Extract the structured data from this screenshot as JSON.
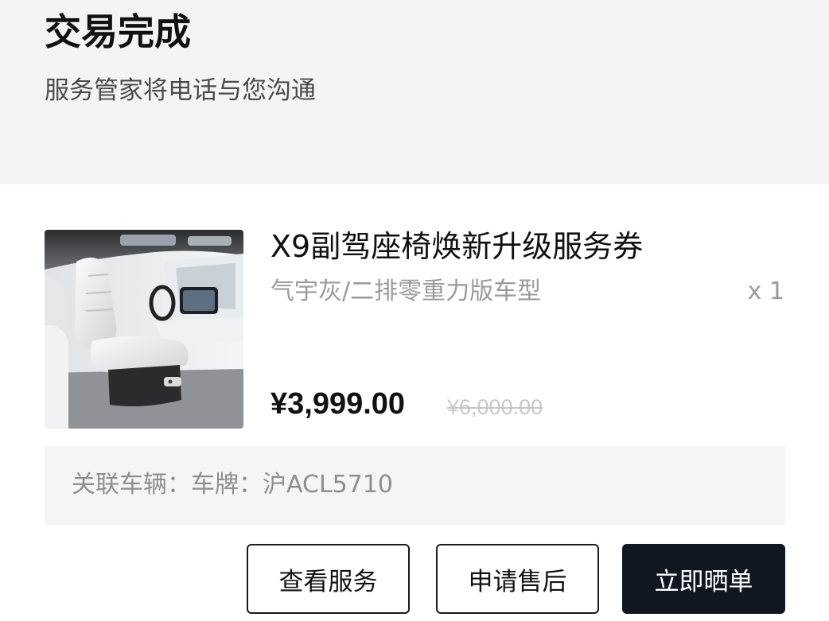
{
  "status": {
    "title": "交易完成",
    "subtitle": "服务管家将电话与您沟通",
    "background": "#f4f4f4"
  },
  "order_item": {
    "image_icon": "car-seat-interior-image",
    "name": "X9副驾座椅焕新升级服务券",
    "variant": "气宇灰/二排零重力版车型",
    "quantity": "x 1",
    "price": "¥3,999.00",
    "original_price": "¥6,000.00"
  },
  "vehicle": {
    "text": "关联车辆：车牌：沪ACL5710"
  },
  "actions": {
    "view_service": "查看服务",
    "after_sales": "申请售后",
    "share_order": "立即晒单",
    "primary_color": "#111722"
  }
}
